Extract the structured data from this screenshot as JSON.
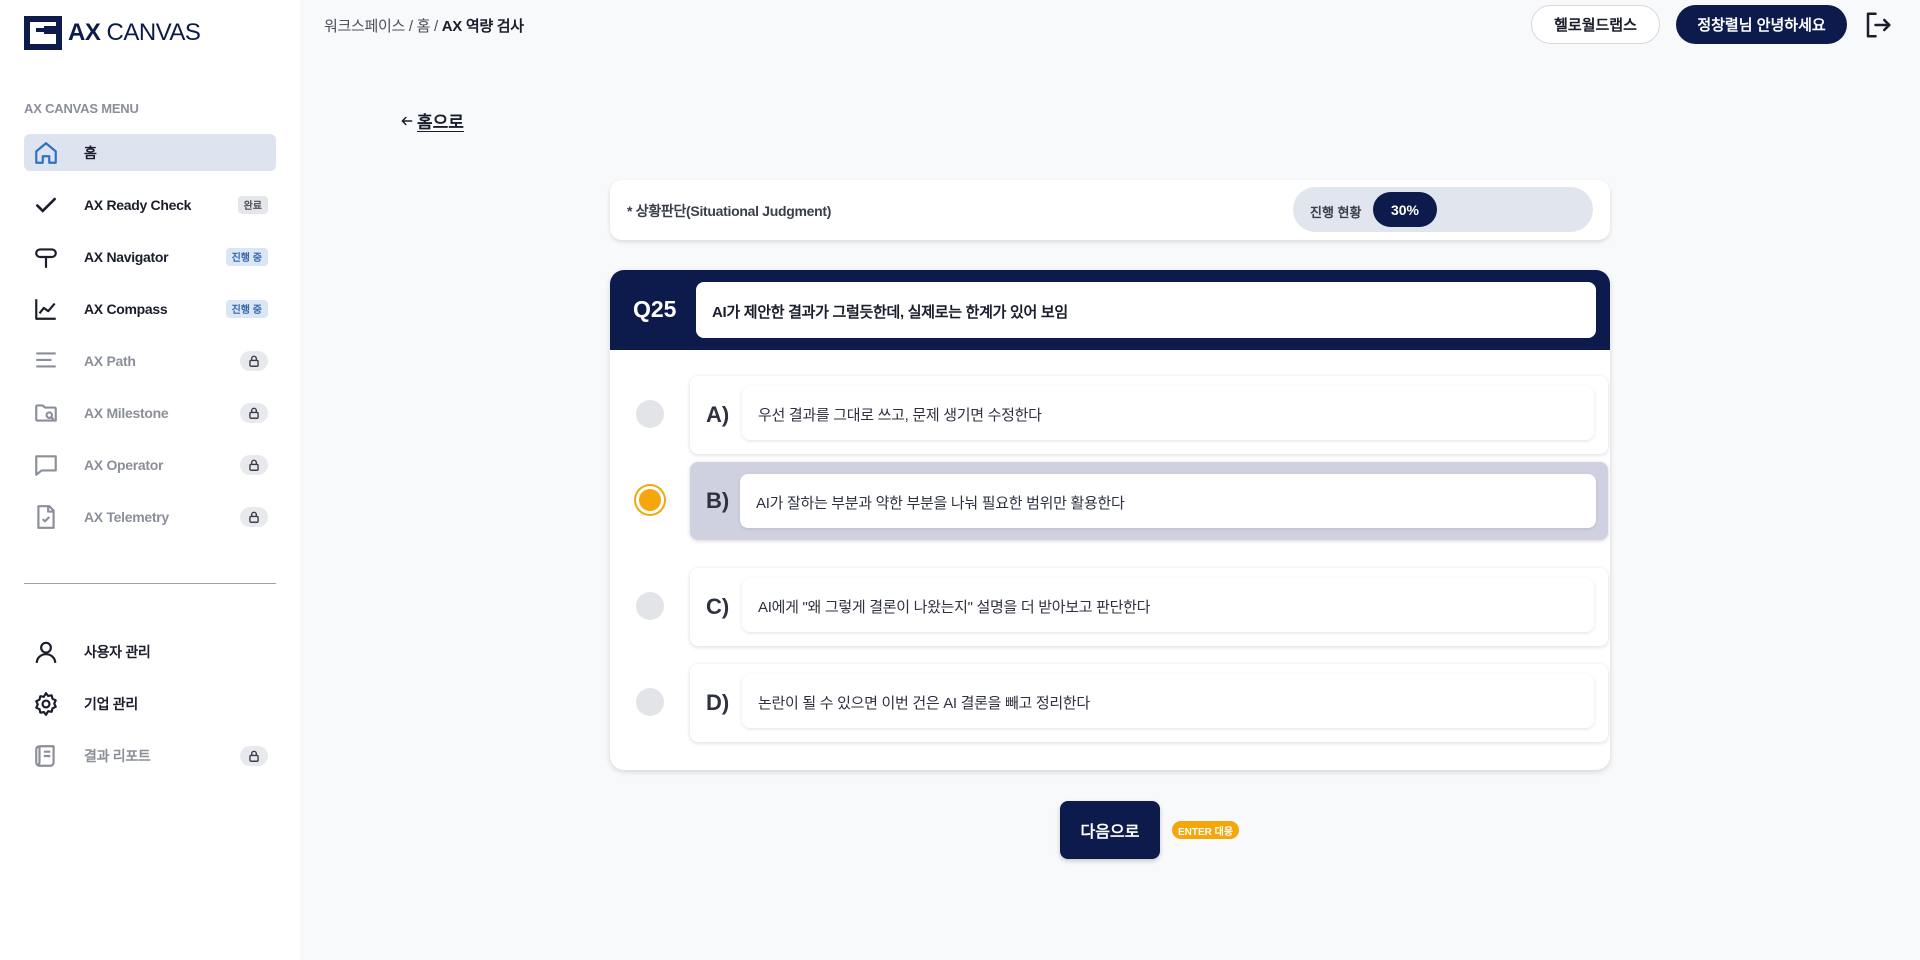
{
  "app": {
    "logo_text_bold": "AX",
    "logo_text_light": "CANVAS"
  },
  "sidebar": {
    "caption": "AX CANVAS MENU",
    "items": [
      {
        "label": "홈",
        "icon": "home-icon",
        "active": true
      },
      {
        "label": "AX Ready Check",
        "icon": "check-icon",
        "badge": "완료"
      },
      {
        "label": "AX Navigator",
        "icon": "signpost-icon",
        "badge": "진행 중"
      },
      {
        "label": "AX Compass",
        "icon": "line-chart-icon",
        "badge": "진행 중"
      },
      {
        "label": "AX Path",
        "icon": "text-lines-icon",
        "locked": true
      },
      {
        "label": "AX Milestone",
        "icon": "folder-search-icon",
        "locked": true
      },
      {
        "label": "AX Operator",
        "icon": "chat-icon",
        "locked": true
      },
      {
        "label": "AX Telemetry",
        "icon": "file-check-icon",
        "locked": true
      }
    ],
    "admin_items": [
      {
        "label": "사용자 관리",
        "icon": "user-icon"
      },
      {
        "label": "기업 관리",
        "icon": "gear-icon"
      },
      {
        "label": "결과 리포트",
        "icon": "scroll-icon",
        "locked": true
      }
    ]
  },
  "header": {
    "breadcrumb": [
      "워크스페이스",
      "홈",
      "AX 역량 검사"
    ],
    "breadcrumb_sep": " / ",
    "workspace_button": "헬로월드랩스",
    "user_button": "정창렬님 안녕하세요",
    "logout_icon": "logout-icon"
  },
  "main": {
    "back_label": "홈으로",
    "status": {
      "category": "* 상황판단(Situational Judgment)",
      "progress_label": "진행 현황",
      "progress_text": "30%",
      "progress_value": 0.3
    },
    "question": {
      "number": "Q25",
      "text": "AI가 제안한 결과가 그럴듯한데, 실제로는 한계가 있어 보임"
    },
    "options": [
      {
        "letter": "A)",
        "text": "우선 결과를 그대로 쓰고, 문제 생기면 수정한다",
        "selected": false
      },
      {
        "letter": "B)",
        "text": "AI가 잘하는 부분과 약한 부분을 나눠 필요한 범위만 활용한다",
        "selected": true
      },
      {
        "letter": "C)",
        "text": "AI에게 \"왜 그렇게 결론이 나왔는지\" 설명을 더 받아보고 판단한다",
        "selected": false
      },
      {
        "letter": "D)",
        "text": "논란이 될 수 있으면 이번 건은 AI 결론을 빼고 정리한다",
        "selected": false
      }
    ],
    "next_button": "다음으로",
    "enter_hint": "ENTER 대응"
  },
  "colors": {
    "brand_navy": "#0d1b4c",
    "accent_orange": "#f5a60a",
    "active_menu_bg": "#dde4f0",
    "selected_option_bg": "#cfd0e0"
  }
}
